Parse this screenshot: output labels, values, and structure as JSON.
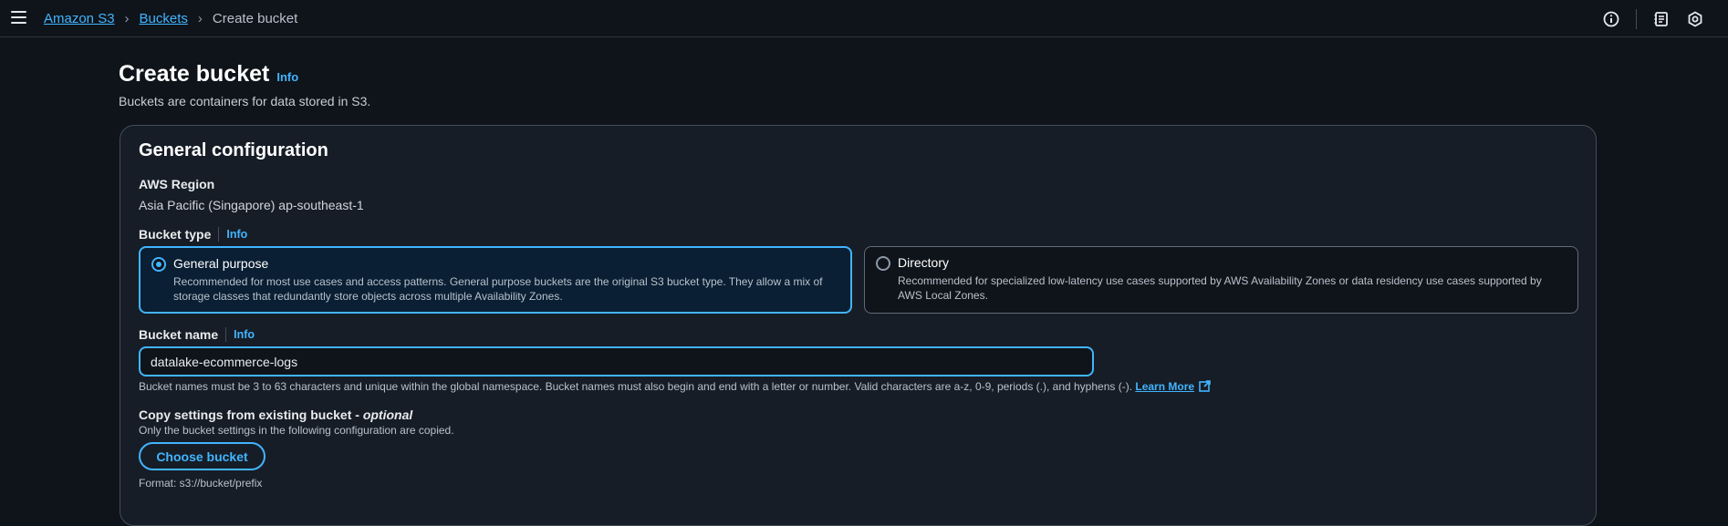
{
  "breadcrumb": {
    "items": [
      "Amazon S3",
      "Buckets"
    ],
    "current": "Create bucket"
  },
  "topbar_icons": [
    "info-circle-icon",
    "notes-icon",
    "settings-hex-icon"
  ],
  "page": {
    "title": "Create bucket",
    "info": "Info",
    "subtitle": "Buckets are containers for data stored in S3."
  },
  "general": {
    "title": "General configuration",
    "region_label": "AWS Region",
    "region_value": "Asia Pacific (Singapore) ap-southeast-1",
    "bucket_type_label": "Bucket type",
    "info": "Info",
    "bucket_types": [
      {
        "title": "General purpose",
        "selected": true,
        "description": "Recommended for most use cases and access patterns. General purpose buckets are the original S3 bucket type. They allow a mix of storage classes that redundantly store objects across multiple Availability Zones."
      },
      {
        "title": "Directory",
        "selected": false,
        "description": "Recommended for specialized low-latency use cases supported by AWS Availability Zones or data residency use cases supported by AWS Local Zones."
      }
    ],
    "bucket_name_label": "Bucket name",
    "bucket_name_value": "datalake-ecommerce-logs",
    "bucket_name_hint": "Bucket names must be 3 to 63 characters and unique within the global namespace. Bucket names must also begin and end with a letter or number. Valid characters are a-z, 0-9, periods (.), and hyphens (-).",
    "learn_more": "Learn More",
    "copy_title": "Copy settings from existing bucket - ",
    "copy_optional": "optional",
    "copy_desc": "Only the bucket settings in the following configuration are copied.",
    "choose_button": "Choose bucket",
    "format_hint": "Format: s3://bucket/prefix"
  },
  "colors": {
    "accent": "#42b4ff",
    "background": "#0f141a",
    "panel": "#161d26",
    "border": "#414d5c"
  }
}
